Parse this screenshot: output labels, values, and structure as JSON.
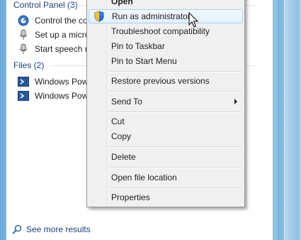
{
  "search_results": {
    "groups": [
      {
        "header": "Control Panel (3)",
        "items": [
          {
            "label": "Control the computer...",
            "icon": "control-panel-icon"
          },
          {
            "label": "Set up a microphone",
            "icon": "microphone-icon"
          },
          {
            "label": "Start speech recognition",
            "icon": "microphone-icon"
          }
        ]
      },
      {
        "header": "Files (2)",
        "items": [
          {
            "label": "Windows PowerShell",
            "icon": "powershell-icon"
          },
          {
            "label": "Windows PowerShell ISE",
            "icon": "powershell-icon"
          }
        ]
      }
    ],
    "see_more": "See more results"
  },
  "context_menu": {
    "items": [
      {
        "label": "Open",
        "bold": true
      },
      {
        "label": "Run as administrator",
        "icon": "uac-shield-icon",
        "highlighted": true
      },
      {
        "label": "Troubleshoot compatibility"
      },
      {
        "label": "Pin to Taskbar"
      },
      {
        "label": "Pin to Start Menu"
      },
      {
        "label": "Restore previous versions"
      },
      {
        "label": "Send To",
        "submenu": true
      },
      {
        "label": "Cut"
      },
      {
        "label": "Copy"
      },
      {
        "label": "Delete"
      },
      {
        "label": "Open file location"
      },
      {
        "label": "Properties"
      }
    ]
  },
  "colors": {
    "header_text": "#1e3e7a",
    "highlight_border": "#a8d1f4",
    "frame_blue": "#8bc2e6"
  }
}
